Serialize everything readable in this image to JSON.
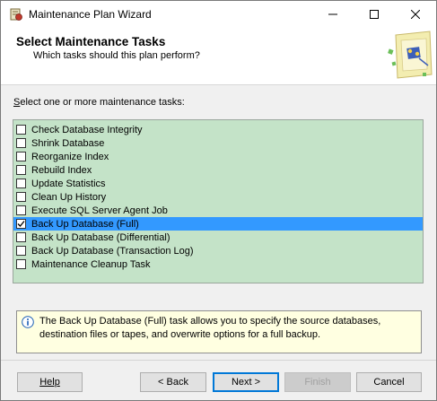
{
  "window": {
    "title": "Maintenance Plan Wizard"
  },
  "header": {
    "title": "Select Maintenance Tasks",
    "subtitle": "Which tasks should this plan perform?"
  },
  "prompt": {
    "accel": "S",
    "rest": "elect one or more maintenance tasks:"
  },
  "tasks": [
    {
      "label": "Check Database Integrity",
      "checked": false,
      "selected": false
    },
    {
      "label": "Shrink Database",
      "checked": false,
      "selected": false
    },
    {
      "label": "Reorganize Index",
      "checked": false,
      "selected": false
    },
    {
      "label": "Rebuild Index",
      "checked": false,
      "selected": false
    },
    {
      "label": "Update Statistics",
      "checked": false,
      "selected": false
    },
    {
      "label": "Clean Up History",
      "checked": false,
      "selected": false
    },
    {
      "label": "Execute SQL Server Agent Job",
      "checked": false,
      "selected": false
    },
    {
      "label": "Back Up Database (Full)",
      "checked": true,
      "selected": true
    },
    {
      "label": "Back Up Database (Differential)",
      "checked": false,
      "selected": false
    },
    {
      "label": "Back Up Database (Transaction Log)",
      "checked": false,
      "selected": false
    },
    {
      "label": "Maintenance Cleanup Task",
      "checked": false,
      "selected": false
    }
  ],
  "description": {
    "icon": "info-icon",
    "text": "The Back Up Database (Full) task allows you to specify the source databases, destination files or tapes, and overwrite options for a full backup."
  },
  "buttons": {
    "help": "Help",
    "back": "< Back",
    "next": "Next >",
    "finish": "Finish",
    "cancel": "Cancel"
  },
  "colors": {
    "list_background": "#c4e3c8",
    "selection": "#3399ff",
    "description_background": "#ffffe1"
  }
}
